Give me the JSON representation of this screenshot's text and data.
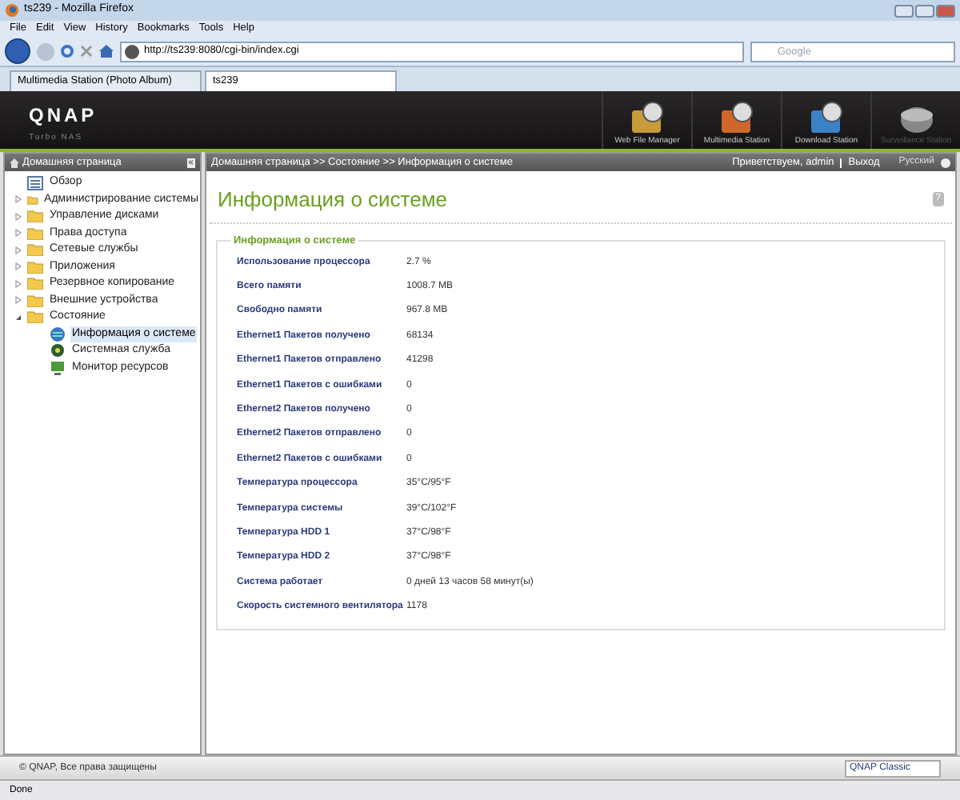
{
  "window": {
    "title": "ts239 - Mozilla Firefox"
  },
  "menu": [
    "File",
    "Edit",
    "View",
    "History",
    "Bookmarks",
    "Tools",
    "Help"
  ],
  "address": {
    "value": "http://ts239:8080/cgi-bin/index.cgi"
  },
  "search": {
    "placeholder": "Google"
  },
  "tabs": [
    {
      "label": "Multimedia Station (Photo Album)",
      "selected": false
    },
    {
      "label": "ts239",
      "selected": true
    }
  ],
  "header": {
    "logo": "QNAP",
    "subtitle": "Turbo NAS",
    "apps": [
      {
        "label": "Web File Manager",
        "disabled": false
      },
      {
        "label": "Multimedia Station",
        "disabled": false
      },
      {
        "label": "Download Station",
        "disabled": false
      },
      {
        "label": "Surveillance Station",
        "disabled": true
      }
    ]
  },
  "sidebar": {
    "title": "Домашняя страница",
    "collapse": "«",
    "items": [
      {
        "label": "Обзор",
        "kind": "page",
        "selected": false
      },
      {
        "label": "Администрирование системы",
        "kind": "folder",
        "expanded": false,
        "selected": false
      },
      {
        "label": "Управление дисками",
        "kind": "folder",
        "expanded": false,
        "selected": false
      },
      {
        "label": "Права доступа",
        "kind": "folder",
        "expanded": false,
        "selected": false
      },
      {
        "label": "Сетевые службы",
        "kind": "folder",
        "expanded": false,
        "selected": false
      },
      {
        "label": "Приложения",
        "kind": "folder",
        "expanded": false,
        "selected": false
      },
      {
        "label": "Резервное копирование",
        "kind": "folder",
        "expanded": false,
        "selected": false
      },
      {
        "label": "Внешние устройства",
        "kind": "folder",
        "expanded": false,
        "selected": false
      },
      {
        "label": "Состояние",
        "kind": "folder",
        "expanded": true,
        "selected": false,
        "children": [
          {
            "label": "Информация о системе",
            "kind": "info",
            "selected": true
          },
          {
            "label": "Системная служба",
            "kind": "service",
            "selected": false
          },
          {
            "label": "Монитор ресурсов",
            "kind": "monitor",
            "selected": false
          }
        ]
      }
    ]
  },
  "breadcrumb": "Домашняя страница >> Состояние >> Информация о системе",
  "user": {
    "greeting": "Приветствуем, admin",
    "logout": "Выход",
    "language": "Русский"
  },
  "page": {
    "title": "Информация о системе",
    "help": "?",
    "section": "Информация о системе",
    "rows": [
      {
        "label": "Использование процессора",
        "value": "2.7 %"
      },
      {
        "label": "Всего памяти",
        "value": "1008.7 MB"
      },
      {
        "label": "Свободно памяти",
        "value": "967.8 MB"
      },
      {
        "label": "Ethernet1 Пакетов получено",
        "value": "68134"
      },
      {
        "label": "Ethernet1 Пакетов отправлено",
        "value": "41298"
      },
      {
        "label": "Ethernet1 Пакетов с ошибками",
        "value": "0"
      },
      {
        "label": "Ethernet2 Пакетов получено",
        "value": "0"
      },
      {
        "label": "Ethernet2 Пакетов отправлено",
        "value": "0"
      },
      {
        "label": "Ethernet2 Пакетов с ошибками",
        "value": "0"
      },
      {
        "label": "Температура процессора",
        "value": "35°C/95°F"
      },
      {
        "label": "Температура системы",
        "value": "39°C/102°F"
      },
      {
        "label": "Температура HDD 1",
        "value": "37°C/98°F"
      },
      {
        "label": "Температура HDD 2",
        "value": "37°C/98°F"
      },
      {
        "label": "Система работает",
        "value": "0 дней 13 часов 58 минут(ы)"
      },
      {
        "label": "Скорость системного вентилятора",
        "value": "1178"
      }
    ]
  },
  "footer": {
    "copyright": "© QNAP, Все права защищены",
    "theme": "QNAP Classic"
  },
  "status_bar": "Done"
}
